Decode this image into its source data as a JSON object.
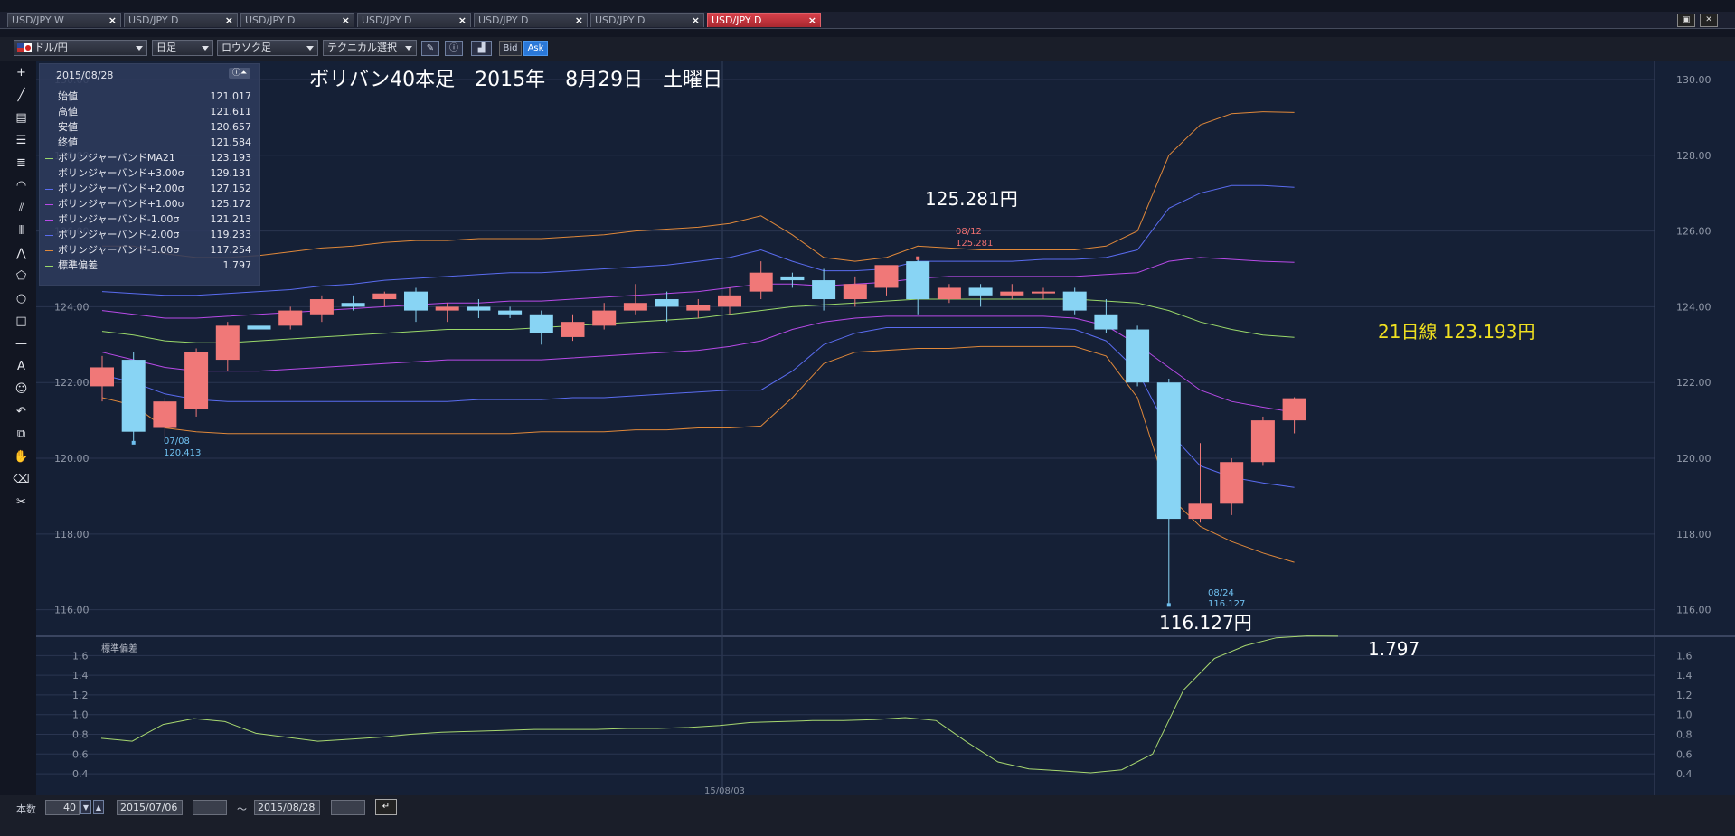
{
  "tabs": [
    {
      "label": "USD/JPY W",
      "active": false
    },
    {
      "label": "USD/JPY D",
      "active": false
    },
    {
      "label": "USD/JPY D",
      "active": false
    },
    {
      "label": "USD/JPY D",
      "active": false
    },
    {
      "label": "USD/JPY D",
      "active": false
    },
    {
      "label": "USD/JPY D",
      "active": false
    },
    {
      "label": "USD/JPY D",
      "active": true
    }
  ],
  "tab_close_glyph": "×",
  "toolbar": {
    "currency_pair": "ドル/円",
    "timeframe": "日足",
    "chart_style": "ロウソク足",
    "technical_select": "テクニカル選択",
    "bid_label": "Bid",
    "ask_label": "Ask"
  },
  "info_panel": {
    "date": "2015/08/28",
    "rows": [
      {
        "label": "始値",
        "value": "121.017",
        "color": ""
      },
      {
        "label": "高値",
        "value": "121.611",
        "color": ""
      },
      {
        "label": "安値",
        "value": "120.657",
        "color": ""
      },
      {
        "label": "終値",
        "value": "121.584",
        "color": ""
      },
      {
        "label": "ボリンジャーバンドMA21",
        "value": "123.193",
        "color": "#9ad86a"
      },
      {
        "label": "ボリンジャーバンド+3.00σ",
        "value": "129.131",
        "color": "#e0883a"
      },
      {
        "label": "ボリンジャーバンド+2.00σ",
        "value": "127.152",
        "color": "#5a6cf0"
      },
      {
        "label": "ボリンジャーバンド+1.00σ",
        "value": "125.172",
        "color": "#b84ae8"
      },
      {
        "label": "ボリンジャーバンド-1.00σ",
        "value": "121.213",
        "color": "#b84ae8"
      },
      {
        "label": "ボリンジャーバンド-2.00σ",
        "value": "119.233",
        "color": "#5a6cf0"
      },
      {
        "label": "ボリンジャーバンド-3.00σ",
        "value": "117.254",
        "color": "#e0883a"
      },
      {
        "label": "標準偏差",
        "value": "1.797",
        "color": "#9ad86a"
      }
    ]
  },
  "annotations": {
    "title": "ボリバン40本足　2015年　8月29日　土曜日",
    "high_label": "125.281円",
    "low_label": "116.127円",
    "ma_label": "21日線 123.193円",
    "sd_label": "1.797",
    "high_marker_date": "08/12",
    "high_marker_value": "125.281",
    "low_marker_date": "08/24",
    "low_marker_value": "116.127",
    "low1_marker_date": "07/08",
    "low1_marker_value": "120.413"
  },
  "colors": {
    "up": "#f07878",
    "down": "#88d4f4",
    "plus3": "#e0883a",
    "plus2": "#5a6cf0",
    "plus1": "#b84ae8",
    "ma": "#9ad86a",
    "sd": "#a8d870",
    "annotation_yellow": "#f0e020",
    "high_marker": "#f07070",
    "low_marker": "#6fc0f0"
  },
  "chart_data": {
    "type": "candlestick",
    "title": "ボリバン40本足　2015年　8月29日　土曜日",
    "ylim": [
      115.3,
      130.5
    ],
    "y_ticks": [
      "130.00",
      "128.00",
      "126.00",
      "124.00",
      "122.00",
      "120.00",
      "118.00",
      "116.00"
    ],
    "x_tick_label": "15/08/03",
    "candles": [
      {
        "o": 121.9,
        "h": 122.7,
        "l": 121.5,
        "c": 122.4
      },
      {
        "o": 122.6,
        "h": 122.8,
        "l": 120.41,
        "c": 120.7
      },
      {
        "o": 120.8,
        "h": 121.6,
        "l": 120.5,
        "c": 121.5
      },
      {
        "o": 121.3,
        "h": 122.9,
        "l": 121.1,
        "c": 122.8
      },
      {
        "o": 122.6,
        "h": 123.6,
        "l": 122.3,
        "c": 123.5
      },
      {
        "o": 123.5,
        "h": 123.8,
        "l": 123.3,
        "c": 123.4
      },
      {
        "o": 123.5,
        "h": 124.0,
        "l": 123.4,
        "c": 123.9
      },
      {
        "o": 123.8,
        "h": 124.3,
        "l": 123.6,
        "c": 124.2
      },
      {
        "o": 124.1,
        "h": 124.3,
        "l": 123.9,
        "c": 124.0
      },
      {
        "o": 124.2,
        "h": 124.4,
        "l": 124.0,
        "c": 124.35
      },
      {
        "o": 124.4,
        "h": 124.5,
        "l": 123.6,
        "c": 123.9
      },
      {
        "o": 123.9,
        "h": 124.1,
        "l": 123.6,
        "c": 124.0
      },
      {
        "o": 124.0,
        "h": 124.2,
        "l": 123.7,
        "c": 123.9
      },
      {
        "o": 123.9,
        "h": 124.0,
        "l": 123.7,
        "c": 123.8
      },
      {
        "o": 123.8,
        "h": 123.9,
        "l": 123.0,
        "c": 123.3
      },
      {
        "o": 123.2,
        "h": 123.8,
        "l": 123.1,
        "c": 123.6
      },
      {
        "o": 123.5,
        "h": 124.1,
        "l": 123.4,
        "c": 123.9
      },
      {
        "o": 123.9,
        "h": 124.6,
        "l": 123.8,
        "c": 124.1
      },
      {
        "o": 124.2,
        "h": 124.4,
        "l": 123.6,
        "c": 124.0
      },
      {
        "o": 123.9,
        "h": 124.2,
        "l": 123.7,
        "c": 124.05
      },
      {
        "o": 124.0,
        "h": 124.5,
        "l": 123.8,
        "c": 124.3
      },
      {
        "o": 124.4,
        "h": 125.2,
        "l": 124.2,
        "c": 124.9
      },
      {
        "o": 124.8,
        "h": 124.9,
        "l": 124.5,
        "c": 124.7
      },
      {
        "o": 124.7,
        "h": 125.0,
        "l": 123.9,
        "c": 124.2
      },
      {
        "o": 124.2,
        "h": 124.8,
        "l": 124.0,
        "c": 124.6
      },
      {
        "o": 124.5,
        "h": 125.0,
        "l": 124.3,
        "c": 125.1
      },
      {
        "o": 125.2,
        "h": 125.281,
        "l": 123.8,
        "c": 124.2
      },
      {
        "o": 124.2,
        "h": 124.6,
        "l": 124.1,
        "c": 124.5
      },
      {
        "o": 124.5,
        "h": 124.6,
        "l": 124.0,
        "c": 124.3
      },
      {
        "o": 124.3,
        "h": 124.6,
        "l": 124.2,
        "c": 124.4
      },
      {
        "o": 124.4,
        "h": 124.5,
        "l": 124.2,
        "c": 124.4
      },
      {
        "o": 124.4,
        "h": 124.5,
        "l": 123.8,
        "c": 123.9
      },
      {
        "o": 123.8,
        "h": 124.2,
        "l": 123.3,
        "c": 123.4
      },
      {
        "o": 123.4,
        "h": 123.5,
        "l": 121.9,
        "c": 122.0
      },
      {
        "o": 122.0,
        "h": 122.1,
        "l": 116.127,
        "c": 118.4
      },
      {
        "o": 118.4,
        "h": 120.4,
        "l": 118.3,
        "c": 118.8
      },
      {
        "o": 118.8,
        "h": 120.0,
        "l": 118.5,
        "c": 119.9
      },
      {
        "o": 119.9,
        "h": 121.1,
        "l": 119.8,
        "c": 121.0
      },
      {
        "o": 121.0,
        "h": 121.611,
        "l": 120.657,
        "c": 121.584
      }
    ],
    "bands": {
      "plus3": [
        125.6,
        125.6,
        125.4,
        125.3,
        125.3,
        125.35,
        125.45,
        125.55,
        125.6,
        125.7,
        125.75,
        125.75,
        125.8,
        125.8,
        125.8,
        125.85,
        125.9,
        126.0,
        126.05,
        126.1,
        126.2,
        126.4,
        125.9,
        125.3,
        125.2,
        125.3,
        125.6,
        125.55,
        125.5,
        125.5,
        125.5,
        125.5,
        125.6,
        126.0,
        128.0,
        128.8,
        129.1,
        129.15,
        129.131
      ],
      "plus2": [
        124.4,
        124.35,
        124.3,
        124.3,
        124.35,
        124.4,
        124.45,
        124.55,
        124.6,
        124.7,
        124.75,
        124.8,
        124.85,
        124.9,
        124.9,
        124.95,
        125.0,
        125.05,
        125.1,
        125.2,
        125.3,
        125.5,
        125.2,
        124.95,
        124.95,
        125.0,
        125.2,
        125.2,
        125.2,
        125.2,
        125.25,
        125.25,
        125.3,
        125.5,
        126.6,
        127.0,
        127.2,
        127.2,
        127.152
      ],
      "plus1": [
        123.9,
        123.8,
        123.7,
        123.7,
        123.75,
        123.8,
        123.85,
        123.9,
        123.95,
        124.0,
        124.05,
        124.1,
        124.1,
        124.15,
        124.15,
        124.2,
        124.25,
        124.3,
        124.35,
        124.4,
        124.5,
        124.6,
        124.6,
        124.55,
        124.6,
        124.65,
        124.75,
        124.8,
        124.8,
        124.8,
        124.8,
        124.8,
        124.85,
        124.9,
        125.2,
        125.3,
        125.25,
        125.2,
        125.172
      ],
      "ma": [
        123.35,
        123.25,
        123.1,
        123.05,
        123.05,
        123.1,
        123.15,
        123.2,
        123.25,
        123.3,
        123.35,
        123.4,
        123.4,
        123.4,
        123.45,
        123.5,
        123.55,
        123.6,
        123.65,
        123.7,
        123.8,
        123.9,
        124.0,
        124.05,
        124.1,
        124.15,
        124.2,
        124.2,
        124.2,
        124.2,
        124.2,
        124.2,
        124.15,
        124.1,
        123.9,
        123.6,
        123.4,
        123.25,
        123.193
      ],
      "minus1": [
        122.8,
        122.6,
        122.4,
        122.3,
        122.3,
        122.3,
        122.35,
        122.4,
        122.45,
        122.5,
        122.55,
        122.6,
        122.6,
        122.6,
        122.6,
        122.65,
        122.7,
        122.75,
        122.8,
        122.85,
        122.95,
        123.1,
        123.4,
        123.6,
        123.7,
        123.75,
        123.75,
        123.75,
        123.75,
        123.75,
        123.75,
        123.7,
        123.5,
        123.0,
        122.4,
        121.8,
        121.5,
        121.35,
        121.213
      ],
      "minus2": [
        122.2,
        122.0,
        121.7,
        121.55,
        121.5,
        121.5,
        121.5,
        121.5,
        121.5,
        121.5,
        121.5,
        121.5,
        121.55,
        121.55,
        121.55,
        121.6,
        121.6,
        121.65,
        121.7,
        121.75,
        121.8,
        121.8,
        122.3,
        123.0,
        123.3,
        123.45,
        123.45,
        123.45,
        123.45,
        123.45,
        123.45,
        123.4,
        123.1,
        122.3,
        120.7,
        119.8,
        119.5,
        119.35,
        119.233
      ],
      "minus3": [
        121.6,
        121.4,
        120.8,
        120.7,
        120.65,
        120.65,
        120.65,
        120.65,
        120.65,
        120.65,
        120.65,
        120.65,
        120.65,
        120.65,
        120.7,
        120.7,
        120.7,
        120.75,
        120.75,
        120.8,
        120.8,
        120.85,
        121.6,
        122.5,
        122.8,
        122.85,
        122.9,
        122.9,
        122.95,
        122.95,
        122.95,
        122.95,
        122.7,
        121.6,
        119.0,
        118.2,
        117.8,
        117.5,
        117.254
      ]
    },
    "sd_series": {
      "name": "標準偏差",
      "ylim": [
        0.3,
        1.75
      ],
      "y_ticks": [
        "1.6",
        "1.4",
        "1.2",
        "1.0",
        "0.8",
        "0.6",
        "0.4"
      ],
      "values": [
        0.76,
        0.73,
        0.9,
        0.96,
        0.93,
        0.81,
        0.77,
        0.73,
        0.75,
        0.77,
        0.8,
        0.82,
        0.83,
        0.84,
        0.85,
        0.85,
        0.85,
        0.86,
        0.86,
        0.87,
        0.89,
        0.92,
        0.93,
        0.94,
        0.94,
        0.95,
        0.97,
        0.94,
        0.72,
        0.52,
        0.45,
        0.43,
        0.41,
        0.44,
        0.6,
        1.25,
        1.57,
        1.7,
        1.78,
        1.8,
        1.797
      ]
    }
  },
  "bottom": {
    "bars_label": "本数",
    "bars_value": "40",
    "date_from": "2015/07/06",
    "tilde": "～",
    "date_to": "2015/08/28"
  }
}
